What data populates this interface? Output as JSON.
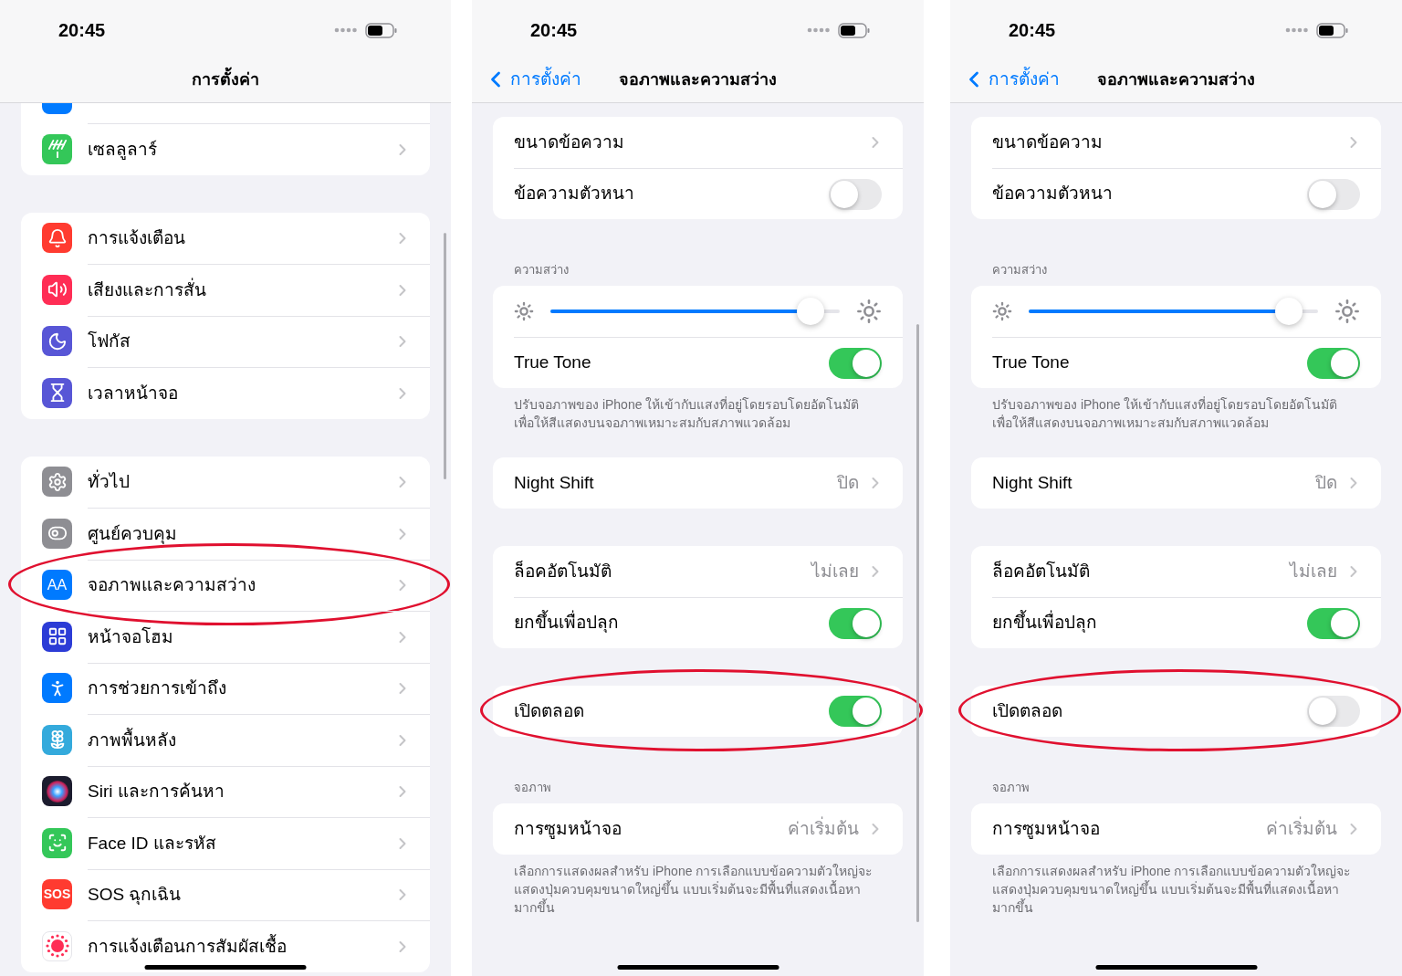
{
  "panels": [
    {
      "kind": "settings_list",
      "status": {
        "time": "20:45"
      },
      "nav": {
        "title": "การตั้งค่า"
      },
      "scrollbar": true,
      "groups": [
        {
          "cut_row_above": true,
          "items": [
            {
              "label": "เซลลูลาร์",
              "color": "#34c759",
              "highlighted": false
            }
          ]
        },
        {
          "items": [
            {
              "label": "การแจ้งเตือน",
              "color": "#ff3b30",
              "highlighted": false
            },
            {
              "label": "เสียงและการสั่น",
              "color": "#ff2d55",
              "highlighted": false
            },
            {
              "label": "โฟกัส",
              "color": "#5856d6",
              "highlighted": false
            },
            {
              "label": "เวลาหน้าจอ",
              "color": "#5856d6",
              "highlighted": false
            }
          ]
        },
        {
          "items": [
            {
              "label": "ทั่วไป",
              "color": "#8e8e93",
              "highlighted": false
            },
            {
              "label": "ศูนย์ควบคุม",
              "color": "#8e8e93",
              "highlighted": false
            },
            {
              "label": "จอภาพและความสว่าง",
              "color": "#007aff",
              "icon_label": "AA",
              "highlighted": true
            },
            {
              "label": "หน้าจอโฮม",
              "color": "#2c3cd6",
              "highlighted": false
            },
            {
              "label": "การช่วยการเข้าถึง",
              "color": "#007aff",
              "highlighted": false
            },
            {
              "label": "ภาพพื้นหลัง",
              "color": "#34aadc",
              "highlighted": false
            },
            {
              "label": "Siri และการค้นหา",
              "color": "#1c1c2e",
              "highlighted": false
            },
            {
              "label": "Face ID และรหัส",
              "color": "#34c759",
              "highlighted": false
            },
            {
              "label": "SOS ฉุกเฉิน",
              "color": "#ff3b30",
              "icon_label": "SOS",
              "highlighted": false
            },
            {
              "label": "การแจ้งเตือนการสัมผัสเชื้อ",
              "color": "#ffffff",
              "highlighted": false
            }
          ]
        }
      ]
    },
    {
      "kind": "display_settings",
      "status": {
        "time": "20:45"
      },
      "nav": {
        "back": "การตั้งค่า",
        "title": "จอภาพและความสว่าง"
      },
      "scrollbar": true,
      "sections": [
        {
          "highlighted": false,
          "rows": [
            {
              "kind": "link",
              "label": "ขนาดข้อความ"
            },
            {
              "kind": "toggle",
              "label": "ข้อความตัวหนา",
              "on": false
            }
          ]
        },
        {
          "header": "ความสว่าง",
          "highlighted": false,
          "rows": [
            {
              "kind": "slider",
              "level": 0.9
            },
            {
              "kind": "toggle",
              "label": "True Tone",
              "on": true
            }
          ],
          "footer": "ปรับจอภาพของ iPhone ให้เข้ากับแสงที่อยู่โดยรอบโดยอัตโนมัติ เพื่อให้สีแสดงบนจอภาพเหมาะสมกับสภาพแวดล้อม"
        },
        {
          "highlighted": false,
          "rows": [
            {
              "kind": "link",
              "label": "Night Shift",
              "value": "ปิด"
            }
          ]
        },
        {
          "highlighted": false,
          "rows": [
            {
              "kind": "link",
              "label": "ล็อคอัตโนมัติ",
              "value": "ไม่เลย"
            },
            {
              "kind": "toggle",
              "label": "ยกขึ้นเพื่อปลุก",
              "on": true
            }
          ]
        },
        {
          "highlighted": true,
          "rows": [
            {
              "kind": "toggle",
              "label": "เปิดตลอด",
              "on": true
            }
          ]
        },
        {
          "header": "จอภาพ",
          "highlighted": false,
          "rows": [
            {
              "kind": "link",
              "label": "การซูมหน้าจอ",
              "value": "ค่าเริ่มต้น"
            }
          ],
          "footer": "เลือกการแสดงผลสำหรับ iPhone การเลือกแบบข้อความตัวใหญ่จะแสดงปุ่มควบคุมขนาดใหญ่ขึ้น แบบเริ่มต้นจะมีพื้นที่แสดงเนื้อหามากขึ้น"
        }
      ]
    },
    {
      "kind": "display_settings",
      "status": {
        "time": "20:45"
      },
      "nav": {
        "back": "การตั้งค่า",
        "title": "จอภาพและความสว่าง"
      },
      "scrollbar": false,
      "sections": [
        {
          "highlighted": false,
          "rows": [
            {
              "kind": "link",
              "label": "ขนาดข้อความ"
            },
            {
              "kind": "toggle",
              "label": "ข้อความตัวหนา",
              "on": false
            }
          ]
        },
        {
          "header": "ความสว่าง",
          "highlighted": false,
          "rows": [
            {
              "kind": "slider",
              "level": 0.9
            },
            {
              "kind": "toggle",
              "label": "True Tone",
              "on": true
            }
          ],
          "footer": "ปรับจอภาพของ iPhone ให้เข้ากับแสงที่อยู่โดยรอบโดยอัตโนมัติ เพื่อให้สีแสดงบนจอภาพเหมาะสมกับสภาพแวดล้อม"
        },
        {
          "highlighted": false,
          "rows": [
            {
              "kind": "link",
              "label": "Night Shift",
              "value": "ปิด"
            }
          ]
        },
        {
          "highlighted": false,
          "rows": [
            {
              "kind": "link",
              "label": "ล็อคอัตโนมัติ",
              "value": "ไม่เลย"
            },
            {
              "kind": "toggle",
              "label": "ยกขึ้นเพื่อปลุก",
              "on": true
            }
          ]
        },
        {
          "highlighted": true,
          "rows": [
            {
              "kind": "toggle",
              "label": "เปิดตลอด",
              "on": false
            }
          ]
        },
        {
          "header": "จอภาพ",
          "highlighted": false,
          "rows": [
            {
              "kind": "link",
              "label": "การซูมหน้าจอ",
              "value": "ค่าเริ่มต้น"
            }
          ],
          "footer": "เลือกการแสดงผลสำหรับ iPhone การเลือกแบบข้อความตัวใหญ่จะแสดงปุ่มควบคุมขนาดใหญ่ขึ้น แบบเริ่มต้นจะมีพื้นที่แสดงเนื้อหามากขึ้น"
        }
      ]
    }
  ]
}
